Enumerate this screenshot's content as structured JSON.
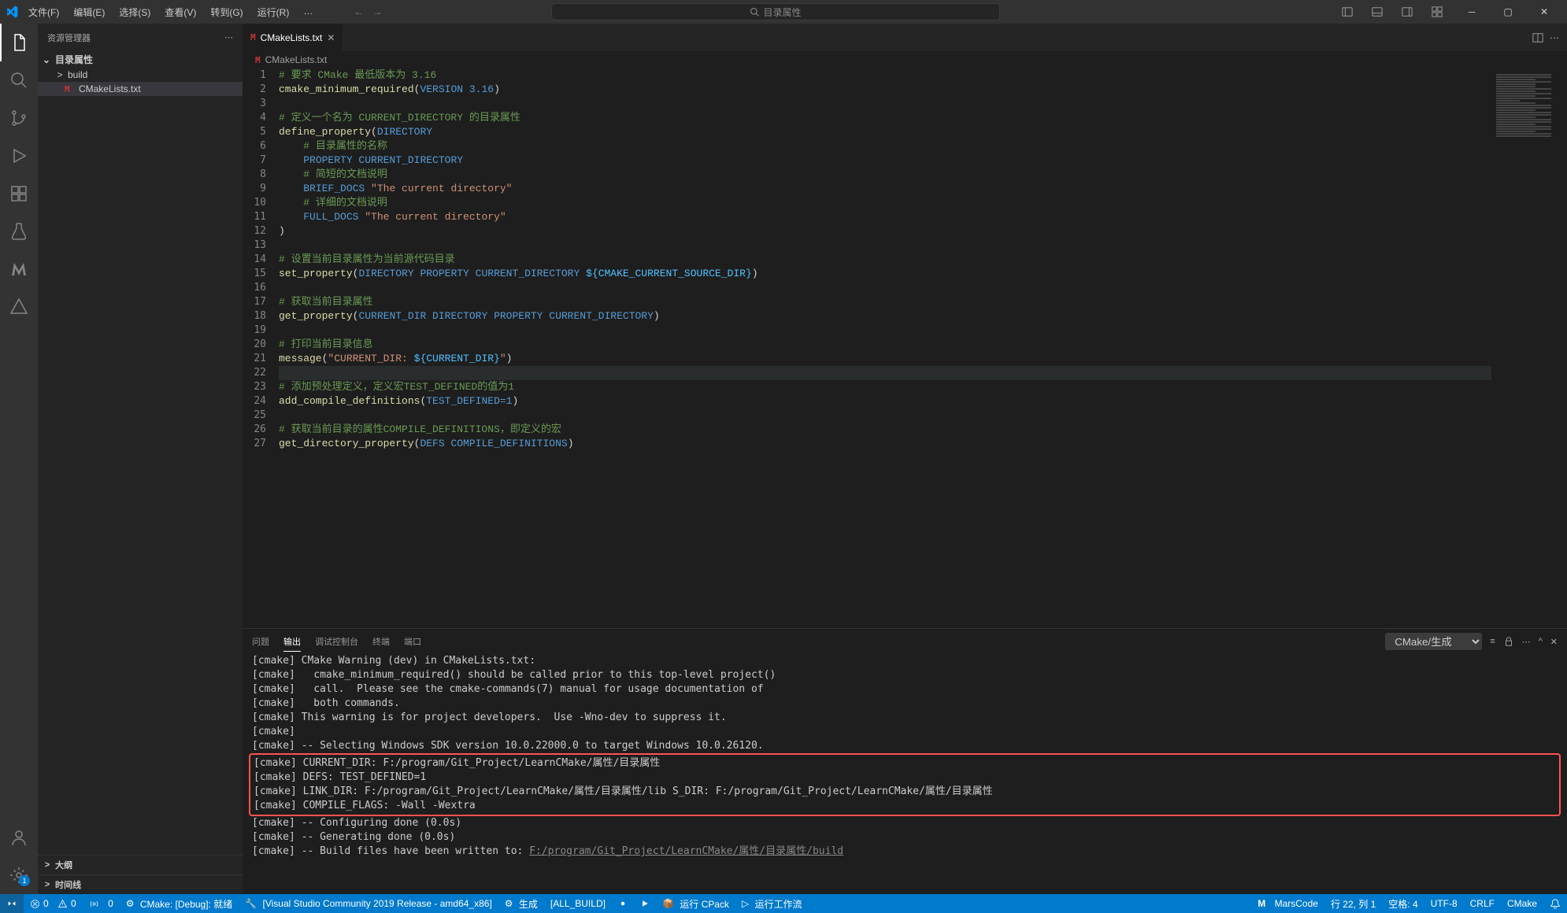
{
  "titlebar": {
    "menus": [
      "文件(F)",
      "编辑(E)",
      "选择(S)",
      "查看(V)",
      "转到(G)",
      "运行(R)"
    ],
    "ellipsis": "…",
    "search_text": "目录属性"
  },
  "activitybar": {
    "badge_settings": "1"
  },
  "sidebar": {
    "title": "资源管理器",
    "root": "目录属性",
    "items": [
      {
        "label": "build",
        "type": "folder"
      },
      {
        "label": "CMakeLists.txt",
        "type": "file"
      }
    ],
    "sections": [
      "大纲",
      "时间线"
    ]
  },
  "tabs": {
    "open": "CMakeLists.txt",
    "breadcrumb": "CMakeLists.txt"
  },
  "editor": {
    "lines": [
      {
        "n": 1,
        "segs": [
          {
            "c": "c-comment",
            "t": "# 要求 CMake 最低版本为 3.16"
          }
        ]
      },
      {
        "n": 2,
        "segs": [
          {
            "c": "c-func",
            "t": "cmake_minimum_required"
          },
          {
            "c": "c-paren",
            "t": "("
          },
          {
            "c": "c-const",
            "t": "VERSION 3.16"
          },
          {
            "c": "c-paren",
            "t": ")"
          }
        ]
      },
      {
        "n": 3,
        "segs": []
      },
      {
        "n": 4,
        "segs": [
          {
            "c": "c-comment",
            "t": "# 定义一个名为 CURRENT_DIRECTORY 的目录属性"
          }
        ]
      },
      {
        "n": 5,
        "segs": [
          {
            "c": "c-func",
            "t": "define_property"
          },
          {
            "c": "c-paren",
            "t": "("
          },
          {
            "c": "c-const",
            "t": "DIRECTORY"
          }
        ]
      },
      {
        "n": 6,
        "indent": "    ",
        "segs": [
          {
            "c": "c-comment",
            "t": "# 目录属性的名称"
          }
        ]
      },
      {
        "n": 7,
        "indent": "    ",
        "segs": [
          {
            "c": "c-const",
            "t": "PROPERTY CURRENT_DIRECTORY"
          }
        ]
      },
      {
        "n": 8,
        "indent": "    ",
        "segs": [
          {
            "c": "c-comment",
            "t": "# 简短的文档说明"
          }
        ]
      },
      {
        "n": 9,
        "indent": "    ",
        "segs": [
          {
            "c": "c-const",
            "t": "BRIEF_DOCS "
          },
          {
            "c": "c-str",
            "t": "\"The current directory\""
          }
        ]
      },
      {
        "n": 10,
        "indent": "    ",
        "segs": [
          {
            "c": "c-comment",
            "t": "# 详细的文档说明"
          }
        ]
      },
      {
        "n": 11,
        "indent": "    ",
        "segs": [
          {
            "c": "c-const",
            "t": "FULL_DOCS "
          },
          {
            "c": "c-str",
            "t": "\"The current directory\""
          }
        ]
      },
      {
        "n": 12,
        "segs": [
          {
            "c": "c-paren",
            "t": ")"
          }
        ]
      },
      {
        "n": 13,
        "segs": []
      },
      {
        "n": 14,
        "segs": [
          {
            "c": "c-comment",
            "t": "# 设置当前目录属性为当前源代码目录"
          }
        ]
      },
      {
        "n": 15,
        "segs": [
          {
            "c": "c-func",
            "t": "set_property"
          },
          {
            "c": "c-paren",
            "t": "("
          },
          {
            "c": "c-const",
            "t": "DIRECTORY PROPERTY CURRENT_DIRECTORY "
          },
          {
            "c": "c-var",
            "t": "${"
          },
          {
            "c": "c-var",
            "t": "CMAKE_CURRENT_SOURCE_DIR"
          },
          {
            "c": "c-var",
            "t": "}"
          },
          {
            "c": "c-paren",
            "t": ")"
          }
        ]
      },
      {
        "n": 16,
        "segs": []
      },
      {
        "n": 17,
        "segs": [
          {
            "c": "c-comment",
            "t": "# 获取当前目录属性"
          }
        ]
      },
      {
        "n": 18,
        "segs": [
          {
            "c": "c-func",
            "t": "get_property"
          },
          {
            "c": "c-paren",
            "t": "("
          },
          {
            "c": "c-const",
            "t": "CURRENT_DIR DIRECTORY PROPERTY CURRENT_DIRECTORY"
          },
          {
            "c": "c-paren",
            "t": ")"
          }
        ]
      },
      {
        "n": 19,
        "segs": []
      },
      {
        "n": 20,
        "segs": [
          {
            "c": "c-comment",
            "t": "# 打印当前目录信息"
          }
        ]
      },
      {
        "n": 21,
        "segs": [
          {
            "c": "c-func",
            "t": "message"
          },
          {
            "c": "c-paren",
            "t": "("
          },
          {
            "c": "c-str",
            "t": "\"CURRENT_DIR: "
          },
          {
            "c": "c-var",
            "t": "${CURRENT_DIR}"
          },
          {
            "c": "c-str",
            "t": "\""
          },
          {
            "c": "c-paren",
            "t": ")"
          }
        ]
      },
      {
        "n": 22,
        "current": true,
        "segs": []
      },
      {
        "n": 23,
        "segs": [
          {
            "c": "c-comment",
            "t": "# 添加预处理定义，定义宏TEST_DEFINED的值为1"
          }
        ]
      },
      {
        "n": 24,
        "segs": [
          {
            "c": "c-func",
            "t": "add_compile_definitions"
          },
          {
            "c": "c-paren",
            "t": "("
          },
          {
            "c": "c-const",
            "t": "TEST_DEFINED=1"
          },
          {
            "c": "c-paren",
            "t": ")"
          }
        ]
      },
      {
        "n": 25,
        "segs": []
      },
      {
        "n": 26,
        "segs": [
          {
            "c": "c-comment",
            "t": "# 获取当前目录的属性COMPILE_DEFINITIONS，即定义的宏"
          }
        ]
      },
      {
        "n": 27,
        "segs": [
          {
            "c": "c-func",
            "t": "get_directory_property"
          },
          {
            "c": "c-paren",
            "t": "("
          },
          {
            "c": "c-const",
            "t": "DEFS COMPILE_DEFINITIONS"
          },
          {
            "c": "c-paren",
            "t": ")"
          }
        ]
      }
    ]
  },
  "panel": {
    "tabs": [
      "问题",
      "输出",
      "调试控制台",
      "终端",
      "端口"
    ],
    "active_tab": 1,
    "output_channel": "CMake/生成",
    "lines_pre": [
      "[cmake] CMake Warning (dev) in CMakeLists.txt:",
      "[cmake]   cmake_minimum_required() should be called prior to this top-level project()",
      "[cmake]   call.  Please see the cmake-commands(7) manual for usage documentation of",
      "[cmake]   both commands.",
      "[cmake] This warning is for project developers.  Use -Wno-dev to suppress it.",
      "[cmake] ",
      "[cmake] -- Selecting Windows SDK version 10.0.22000.0 to target Windows 10.0.26120."
    ],
    "lines_hl": [
      "[cmake] CURRENT_DIR: F:/program/Git_Project/LearnCMake/属性/目录属性",
      "[cmake] DEFS: TEST_DEFINED=1",
      "[cmake] LINK_DIR: F:/program/Git_Project/LearnCMake/属性/目录属性/lib S_DIR: F:/program/Git_Project/LearnCMake/属性/目录属性",
      "[cmake] COMPILE_FLAGS: -Wall -Wextra"
    ],
    "lines_post": [
      "[cmake] -- Configuring done (0.0s)",
      "[cmake] -- Generating done (0.0s)"
    ],
    "lines_path": "[cmake] -- Build files have been written to: ",
    "lines_path_link": "F:/program/Git_Project/LearnCMake/属性/目录属性/build"
  },
  "status": {
    "errors": "0",
    "warnings": "0",
    "ports": "0",
    "cmake_status": "CMake: [Debug]: 就绪",
    "kit": "[Visual Studio Community 2019 Release - amd64_x86]",
    "build": "生成",
    "target": "[ALL_BUILD]",
    "cpack": "运行 CPack",
    "workflow": "运行工作流",
    "marscode": "MarsCode",
    "cursor": "行 22, 列 1",
    "spaces": "空格: 4",
    "encoding": "UTF-8",
    "eol": "CRLF",
    "lang": "CMake"
  }
}
